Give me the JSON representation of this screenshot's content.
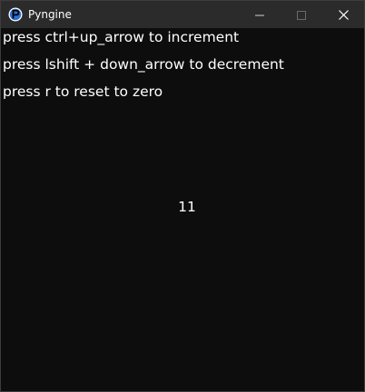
{
  "window": {
    "title": "Pyngine",
    "icon": "pyngine-p-icon",
    "controls": [
      "minimize-icon",
      "maximize-icon",
      "close-icon"
    ]
  },
  "content": {
    "instructions": [
      "press ctrl+up_arrow to increment",
      "press lshift + down_arrow to decrement",
      "press r to reset to zero"
    ],
    "counter": "11"
  },
  "colors": {
    "titlebar": "#2b2b2b",
    "background": "#0d0d0d",
    "text": "#ffffff",
    "icon_blue": "#2f6fd1"
  }
}
